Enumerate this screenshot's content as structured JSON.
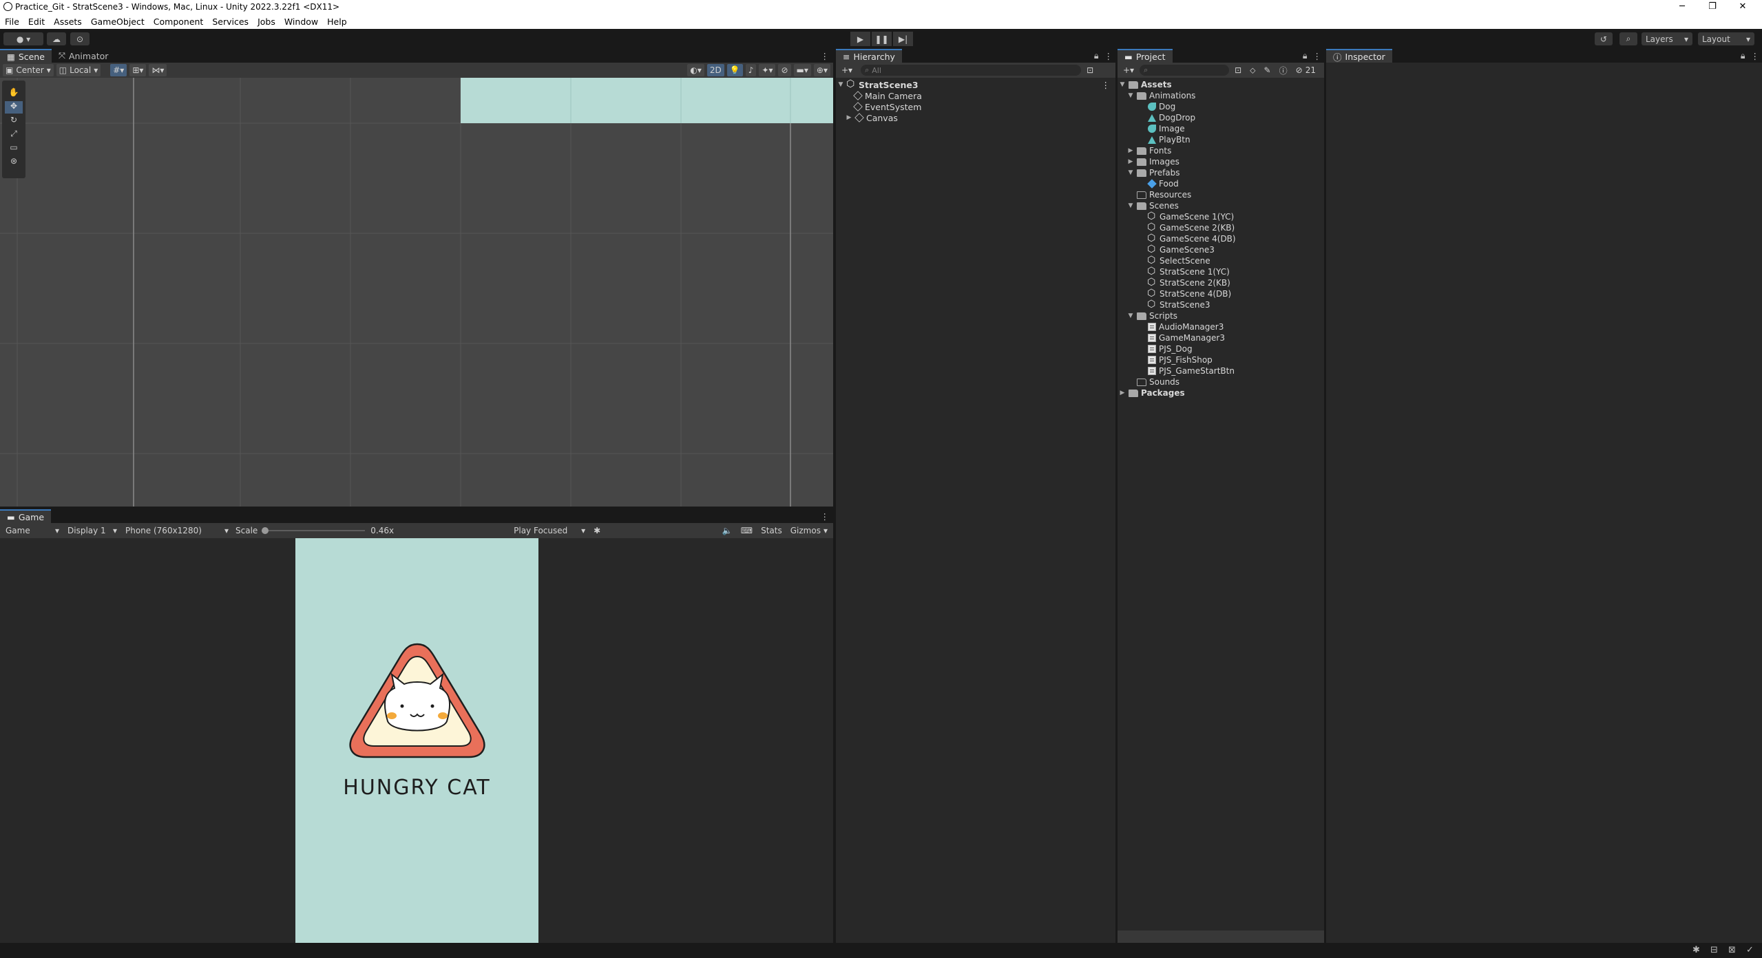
{
  "window": {
    "title": "Practice_Git - StratScene3 - Windows, Mac, Linux - Unity 2022.3.22f1 <DX11>",
    "minimize": "─",
    "maximize": "❐",
    "close": "✕"
  },
  "menu": [
    "File",
    "Edit",
    "Assets",
    "GameObject",
    "Component",
    "Services",
    "Jobs",
    "Window",
    "Help"
  ],
  "toolbar": {
    "account_icon": "account-icon",
    "layers_label": "Layers",
    "layout_label": "Layout"
  },
  "scene_panel": {
    "tabs": [
      "Scene",
      "Animator"
    ],
    "pivot_label": "Center",
    "space_label": "Local",
    "mode_2d_label": "2D"
  },
  "game_panel": {
    "tab": "Game",
    "view_select": "Game",
    "display_select": "Display 1",
    "resolution_select": "Phone (760x1280)",
    "scale_label": "Scale",
    "scale_value": "0.46x",
    "scale_fraction": 0.0,
    "play_mode_select": "Play Focused",
    "stats_label": "Stats",
    "gizmos_label": "Gizmos",
    "game_title": "HUNGRY CAT",
    "bg_color": "#b7dbd5",
    "logo_outer_color": "#e9705a",
    "logo_inner_color": "#fdf5d8"
  },
  "hierarchy": {
    "tab": "Hierarchy",
    "search_placeholder": "All",
    "scene_name": "StratScene3",
    "items": [
      "Main Camera",
      "EventSystem",
      "Canvas"
    ]
  },
  "project": {
    "tab": "Project",
    "hidden_count": "21",
    "root": "Assets",
    "animations_folder": "Animations",
    "animations": [
      "Dog",
      "DogDrop",
      "Image",
      "PlayBtn"
    ],
    "fonts_folder": "Fonts",
    "images_folder": "Images",
    "prefabs_folder": "Prefabs",
    "prefabs": [
      "Food"
    ],
    "resources_folder": "Resources",
    "scenes_folder": "Scenes",
    "scenes": [
      "GameScene 1(YC)",
      "GameScene 2(KB)",
      "GameScene 4(DB)",
      "GameScene3",
      "SelectScene",
      "StratScene 1(YC)",
      "StratScene 2(KB)",
      "StratScene 4(DB)",
      "StratScene3"
    ],
    "scripts_folder": "Scripts",
    "scripts": [
      "AudioManager3",
      "GameManager3",
      "PJS_Dog",
      "PJS_FishShop",
      "PJS_GameStartBtn"
    ],
    "sounds_folder": "Sounds",
    "packages": "Packages"
  },
  "inspector": {
    "tab": "Inspector"
  }
}
